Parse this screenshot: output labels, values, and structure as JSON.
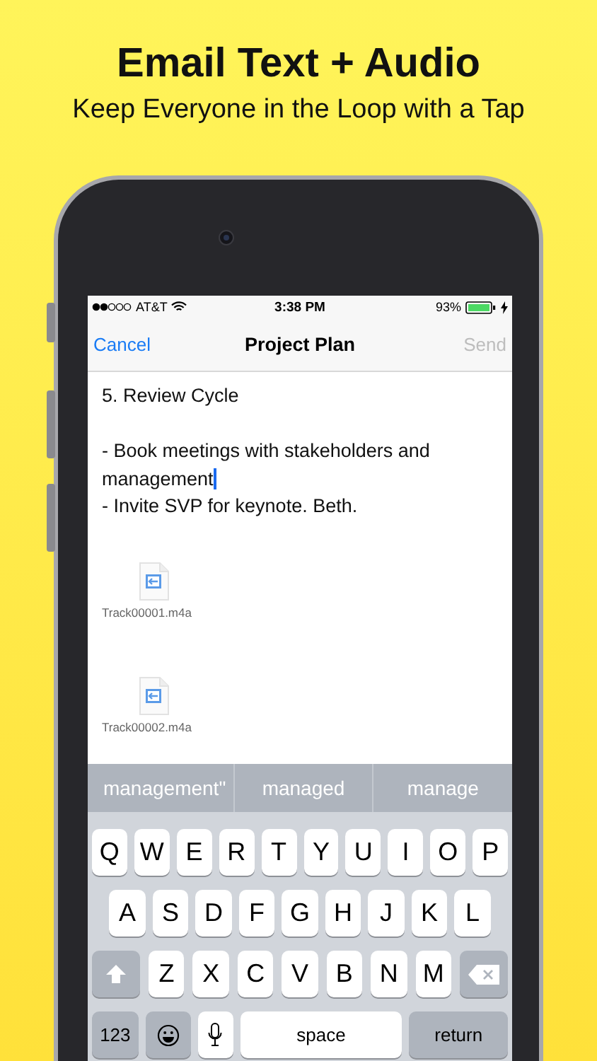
{
  "headline": "Email Text + Audio",
  "subheadline": "Keep Everyone in the Loop with a Tap",
  "status_bar": {
    "carrier": "AT&T",
    "time": "3:38 PM",
    "battery": "93%"
  },
  "nav": {
    "cancel": "Cancel",
    "title": "Project Plan",
    "send": {
      "label": "Send",
      "disabled": true
    }
  },
  "body_heading": "5. Review Cycle",
  "body": [
    {
      "text": "- Book meetings with stakeholders and management",
      "cursor": true
    },
    {
      "text": "- Invite SVP for keynote. Beth.",
      "cursor": false
    }
  ],
  "attachments": [
    {
      "name": "Track00001.m4a"
    },
    {
      "name": "Track00002.m4a"
    }
  ],
  "suggestions": [
    "management\"",
    "managed",
    "manage"
  ],
  "keyboard": {
    "rows": [
      [
        "Q",
        "W",
        "E",
        "R",
        "T",
        "Y",
        "U",
        "I",
        "O",
        "P"
      ],
      [
        "A",
        "S",
        "D",
        "F",
        "G",
        "H",
        "J",
        "K",
        "L"
      ],
      [
        "Z",
        "X",
        "C",
        "V",
        "B",
        "N",
        "M"
      ]
    ],
    "numbers": "123",
    "space": "space",
    "return": "return"
  }
}
